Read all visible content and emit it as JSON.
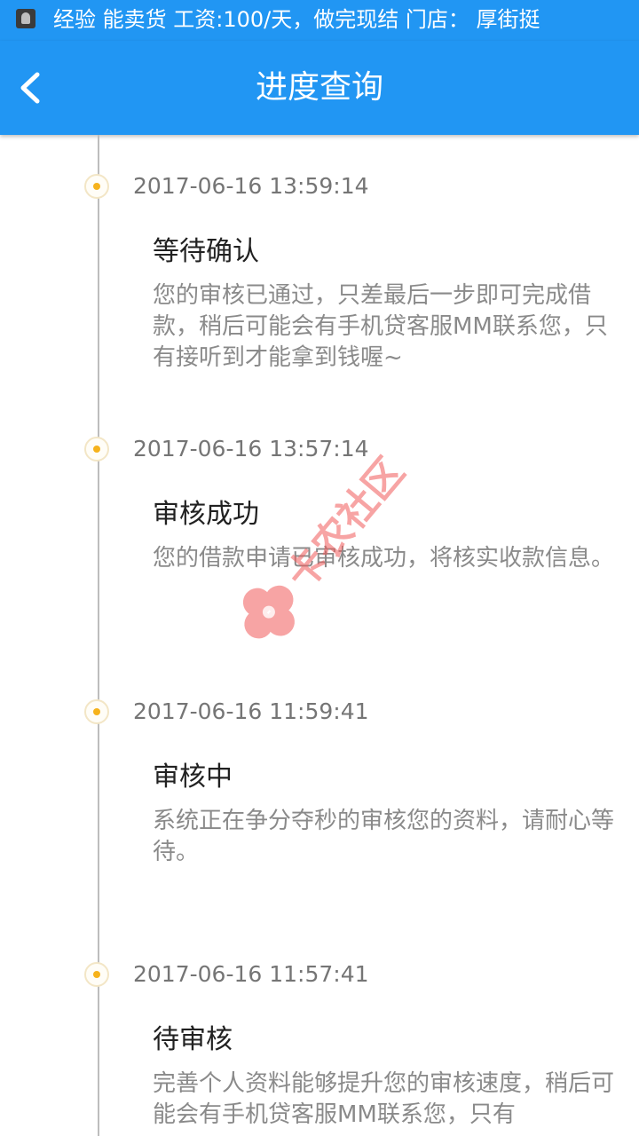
{
  "status_bar": {
    "ticker_text": "经验  能卖货 工资:100/天，做完现结 门店：  厚街挺"
  },
  "header": {
    "title": "进度查询"
  },
  "timeline": [
    {
      "time": "2017-06-16 13:59:14",
      "title": "等待确认",
      "desc": "您的审核已通过，只差最后一步即可完成借款，稍后可能会有手机贷客服MM联系您，只有接听到才能拿到钱喔~"
    },
    {
      "time": "2017-06-16 13:57:14",
      "title": "审核成功",
      "desc": "您的借款申请已审核成功，将核实收款信息。"
    },
    {
      "time": "2017-06-16 11:59:41",
      "title": "审核中",
      "desc": "系统正在争分夺秒的审核您的资料，请耐心等待。"
    },
    {
      "time": "2017-06-16 11:57:41",
      "title": "待审核",
      "desc": "完善个人资料能够提升您的审核速度，稍后可能会有手机贷客服MM联系您，只有"
    }
  ],
  "watermark": {
    "text": "卡农社区"
  },
  "colors": {
    "primary": "#2196f3",
    "dot": "#f6b21b",
    "line": "#bdbdbd",
    "watermark": "#f05a5a"
  }
}
